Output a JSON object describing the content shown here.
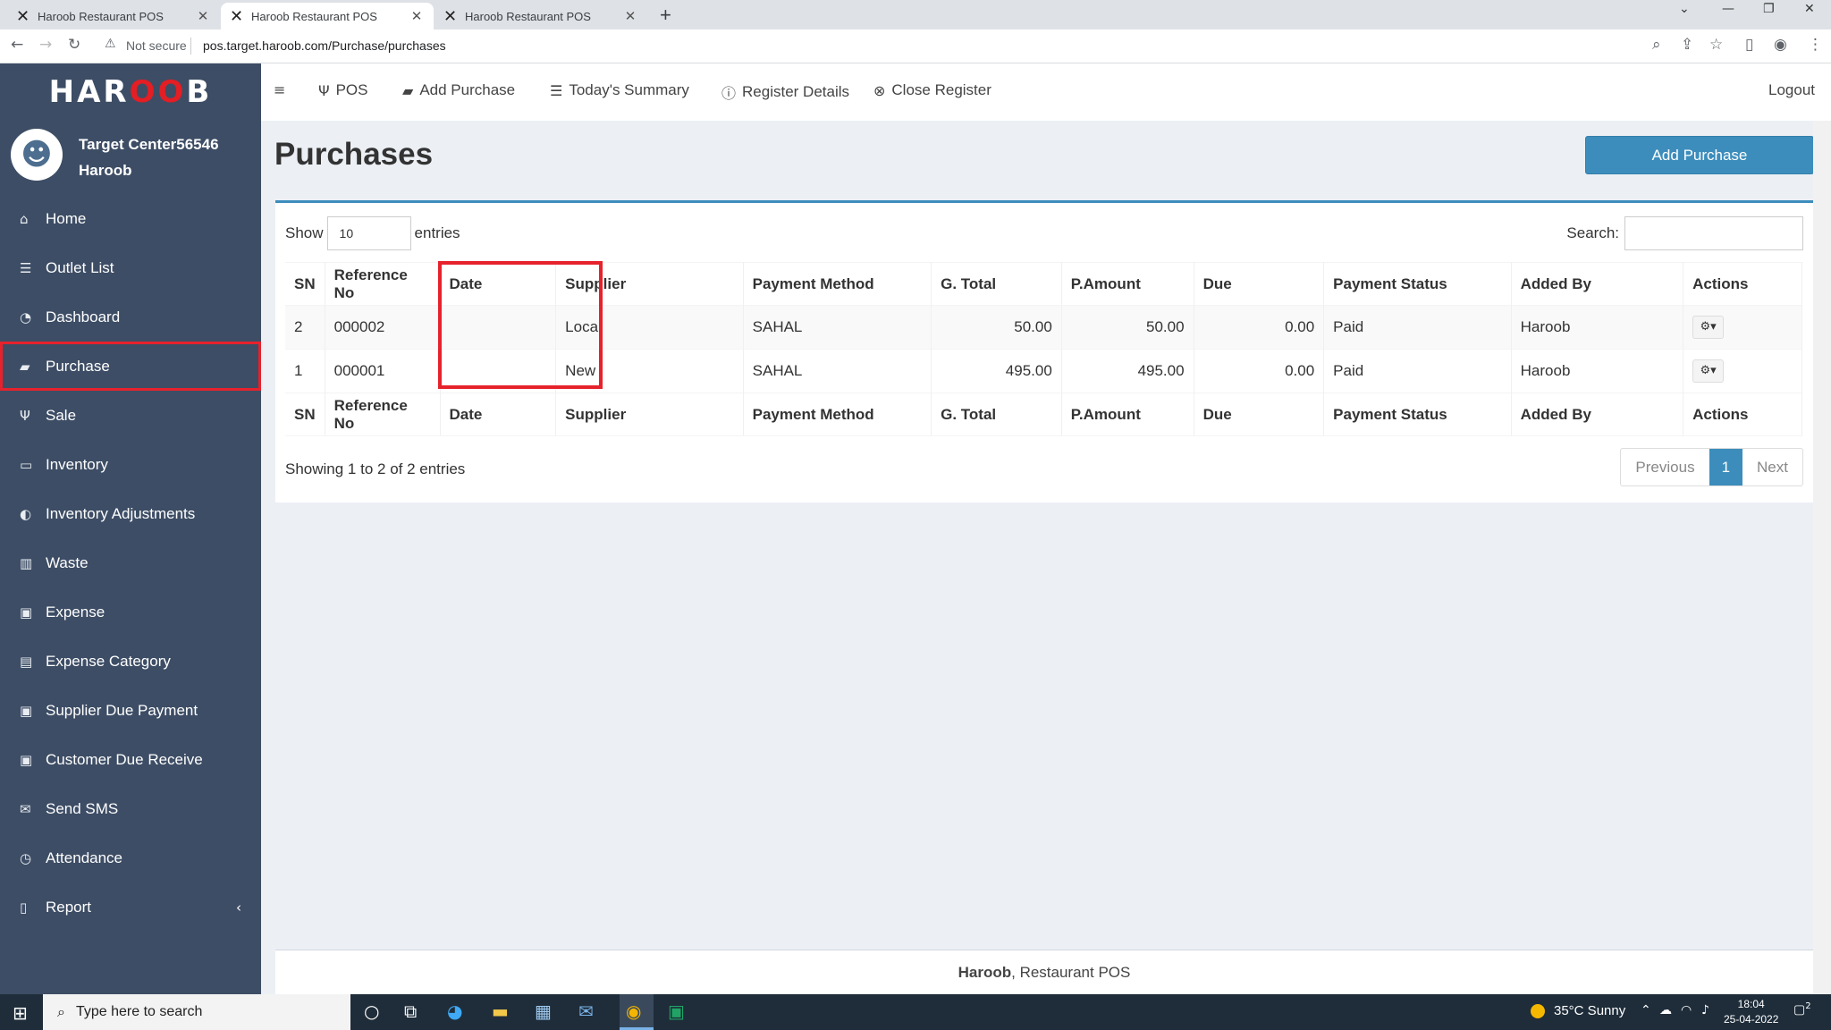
{
  "browser": {
    "tabs": [
      {
        "title": "Haroob Restaurant POS"
      },
      {
        "title": "Haroob Restaurant POS"
      },
      {
        "title": "Haroob Restaurant POS"
      }
    ],
    "security": "Not secure",
    "url": "pos.target.haroob.com/Purchase/purchases"
  },
  "sidebar": {
    "brand": {
      "part1": "HAR",
      "part2": "OO",
      "part3": "B"
    },
    "user": {
      "line1": "Target Center56546",
      "line2": "Haroob"
    },
    "items": [
      {
        "label": "Home",
        "icon": "home-icon"
      },
      {
        "label": "Outlet List",
        "icon": "list-icon"
      },
      {
        "label": "Dashboard",
        "icon": "dashboard-icon"
      },
      {
        "label": "Purchase",
        "icon": "truck-icon"
      },
      {
        "label": "Sale",
        "icon": "cutlery-icon"
      },
      {
        "label": "Inventory",
        "icon": "inbox-icon"
      },
      {
        "label": "Inventory Adjustments",
        "icon": "adjust-icon"
      },
      {
        "label": "Waste",
        "icon": "trash-icon"
      },
      {
        "label": "Expense",
        "icon": "money-icon"
      },
      {
        "label": "Expense Category",
        "icon": "card-icon"
      },
      {
        "label": "Supplier Due Payment",
        "icon": "money-icon"
      },
      {
        "label": "Customer Due Receive",
        "icon": "money-icon"
      },
      {
        "label": "Send SMS",
        "icon": "envelope-icon"
      },
      {
        "label": "Attendance",
        "icon": "clock-icon"
      },
      {
        "label": "Report",
        "icon": "file-icon"
      }
    ]
  },
  "topnav": {
    "pos": "POS",
    "add_purchase": "Add Purchase",
    "summary": "Today's Summary",
    "register_details": "Register Details",
    "close_register": "Close Register",
    "logout": "Logout"
  },
  "page": {
    "title": "Purchases",
    "add_button": "Add Purchase",
    "show_label": "Show",
    "entries_value": "10",
    "entries_label": "entries",
    "search_label": "Search:",
    "info": "Showing 1 to 2 of 2 entries",
    "pager": {
      "previous": "Previous",
      "current": "1",
      "next": "Next"
    }
  },
  "table": {
    "columns": [
      "SN",
      "Reference No",
      "Date",
      "Supplier",
      "Payment Method",
      "G. Total",
      "P.Amount",
      "Due",
      "Payment Status",
      "Added By",
      "Actions"
    ],
    "rows": [
      {
        "sn": "2",
        "ref": "000002",
        "date": "",
        "supplier": "Local",
        "method": "SAHAL",
        "total": "50.00",
        "paid": "50.00",
        "due": "0.00",
        "status": "Paid",
        "added_by": "Haroob"
      },
      {
        "sn": "1",
        "ref": "000001",
        "date": "",
        "supplier": "New",
        "method": "SAHAL",
        "total": "495.00",
        "paid": "495.00",
        "due": "0.00",
        "status": "Paid",
        "added_by": "Haroob"
      }
    ]
  },
  "footer": {
    "brand": "Haroob",
    "text": ", Restaurant POS"
  },
  "taskbar": {
    "search_placeholder": "Type here to search",
    "weather": "35°C  Sunny",
    "time": "18:04",
    "date": "25-04-2022",
    "notifications": "2"
  },
  "colors": {
    "sidebar": "#3d4d65",
    "accent": "#3c8dbc",
    "highlight": "#e6222c"
  }
}
